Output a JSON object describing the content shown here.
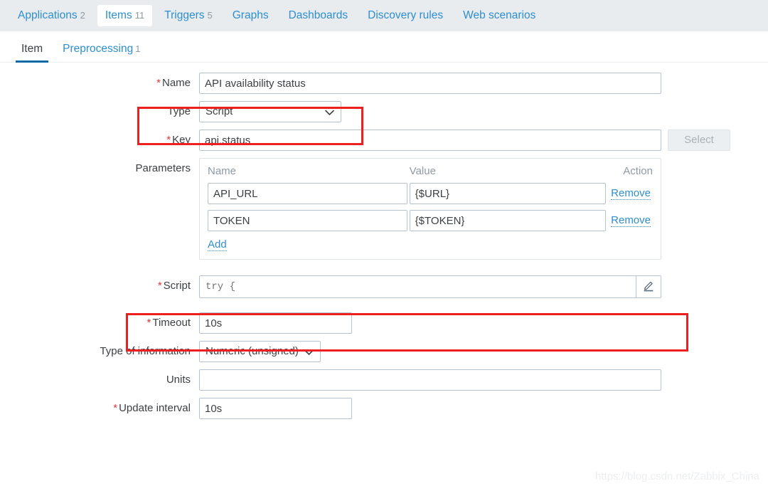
{
  "object_tabs": [
    {
      "label": "Applications",
      "count": "2",
      "selected": false
    },
    {
      "label": "Items",
      "count": "11",
      "selected": true
    },
    {
      "label": "Triggers",
      "count": "5",
      "selected": false
    },
    {
      "label": "Graphs",
      "count": "",
      "selected": false
    },
    {
      "label": "Dashboards",
      "count": "",
      "selected": false
    },
    {
      "label": "Discovery rules",
      "count": "",
      "selected": false
    },
    {
      "label": "Web scenarios",
      "count": "",
      "selected": false
    }
  ],
  "form_tabs": [
    {
      "label": "Item",
      "count": "",
      "active": true
    },
    {
      "label": "Preprocessing",
      "count": "1",
      "active": false
    }
  ],
  "form": {
    "name": {
      "label": "Name",
      "required": "*",
      "value": "API availability status"
    },
    "type": {
      "label": "Type",
      "required": "",
      "value": "Script"
    },
    "key": {
      "label": "Key",
      "required": "*",
      "value": "api.status",
      "select_button": "Select"
    },
    "parameters": {
      "label": "Parameters",
      "headers": {
        "name": "Name",
        "value": "Value",
        "action": "Action"
      },
      "rows": [
        {
          "name": "API_URL",
          "value": "{$URL}",
          "action": "Remove"
        },
        {
          "name": "TOKEN",
          "value": "{$TOKEN}",
          "action": "Remove"
        }
      ],
      "add_label": "Add"
    },
    "script": {
      "label": "Script",
      "required": "*",
      "placeholder": "try {",
      "edit_icon": "pencil-icon"
    },
    "timeout": {
      "label": "Timeout",
      "required": "*",
      "value": "10s"
    },
    "type_of_information": {
      "label": "Type of information",
      "required": "",
      "value": "Numeric (unsigned)"
    },
    "units": {
      "label": "Units",
      "required": "",
      "value": ""
    },
    "update_interval": {
      "label": "Update interval",
      "required": "*",
      "value": "10s"
    }
  },
  "annotations": {
    "type_highlight": "red-highlight-type",
    "script_highlight": "red-highlight-script"
  },
  "watermark": "https://blog.csdn.net/Zabbix_China",
  "colors": {
    "link": "#2e8ece",
    "required": "#e33734",
    "header_bg": "#e8ecef",
    "active_tab_underline": "#0b6aa2",
    "highlight": "#f01f1f"
  }
}
